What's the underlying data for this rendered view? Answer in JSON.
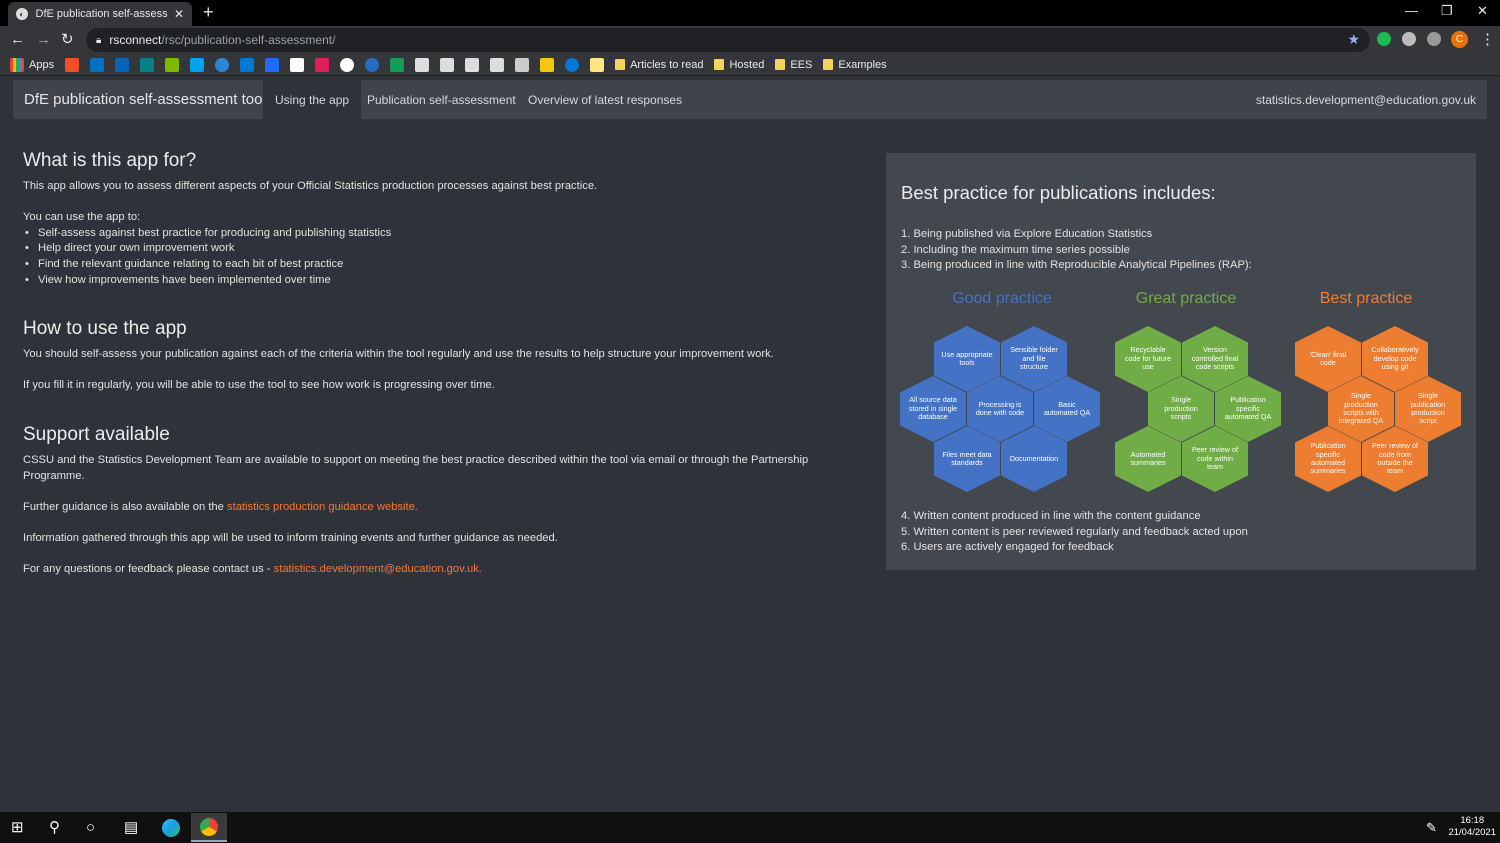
{
  "browser": {
    "tab_title": "DfE publication self-assessment t",
    "url_host": "rsconnect",
    "url_path": "/rsc/publication-self-assessment/",
    "profile_initial": "C",
    "bookmarks": {
      "apps": "Apps",
      "folders": [
        "Articles to read",
        "Hosted",
        "EES",
        "Examples"
      ]
    }
  },
  "navbar": {
    "brand": "DfE publication self-assessment tool",
    "tabs": [
      "Using the app",
      "Publication self-assessment",
      "Overview of latest responses"
    ],
    "active_tab": "Using the app",
    "right_link": "statistics.development@education.gov.uk"
  },
  "main": {
    "what": {
      "heading": "What is this app for?",
      "intro": "This app allows you to assess different aspects of your Official Statistics production processes against best practice.",
      "use_intro": "You can use the app to:",
      "bullets": [
        "Self-assess against best practice for producing and publishing statistics",
        "Help direct your own improvement work",
        "Find the relevant guidance relating to each bit of best practice",
        "View how improvements have been implemented over time"
      ]
    },
    "how": {
      "heading": "How to use the app",
      "p1": "You should self-assess your publication against each of the criteria within the tool regularly and use the results to help structure your improvement work.",
      "p2": "If you fill it in regularly, you will be able to use the tool to see how work is progressing over time."
    },
    "support": {
      "heading": "Support available",
      "p1": "CSSU and the Statistics Development Team are available to support on meeting the best practice described within the tool via email or through the Partnership Programme.",
      "p2_prefix": "Further guidance is also available on the ",
      "p2_link": "statistics production guidance website.",
      "p3": "Information gathered through this app will be used to inform training events and further guidance as needed.",
      "p4_prefix": "For any questions or feedback please contact us - ",
      "p4_link": "statistics.development@education.gov.uk."
    }
  },
  "panel": {
    "heading": "Best practice for publications includes:",
    "list_top": [
      "1. Being published via Explore Education Statistics",
      "2. Including the maximum time series possible",
      "3. Being produced in line with Reproducible Analytical Pipelines (RAP):"
    ],
    "list_bottom": [
      "4. Written content produced in line with the content guidance",
      "5. Written content is peer reviewed regularly and feedback acted upon",
      "6. Users are actively engaged for feedback"
    ],
    "groups": [
      {
        "heading": "Good practice",
        "color": "#4472c4",
        "cells": [
          "Use appropriate tools",
          "Sensible folder and file structure",
          "All source data stored in single database",
          "Processing is done with code",
          "Basic automated QA",
          "Files meet data standards",
          "Documentation"
        ]
      },
      {
        "heading": "Great practice",
        "color": "#70ad47",
        "cells": [
          "Recyclable code for future use",
          "Version controlled final code scripts",
          "Single production scripts",
          "Publication specific automated QA",
          "Automated summaries",
          "Peer review of code within team"
        ]
      },
      {
        "heading": "Best practice",
        "color": "#ed7d31",
        "cells": [
          "'Clean' final code",
          "Collaboratively develop code using git",
          "Single production scripts with integrated QA",
          "Single publication production script",
          "Publication specific automated summaries",
          "Peer review of code from outside the team"
        ]
      }
    ]
  },
  "taskbar": {
    "time": "16:18",
    "date": "21/04/2021"
  }
}
